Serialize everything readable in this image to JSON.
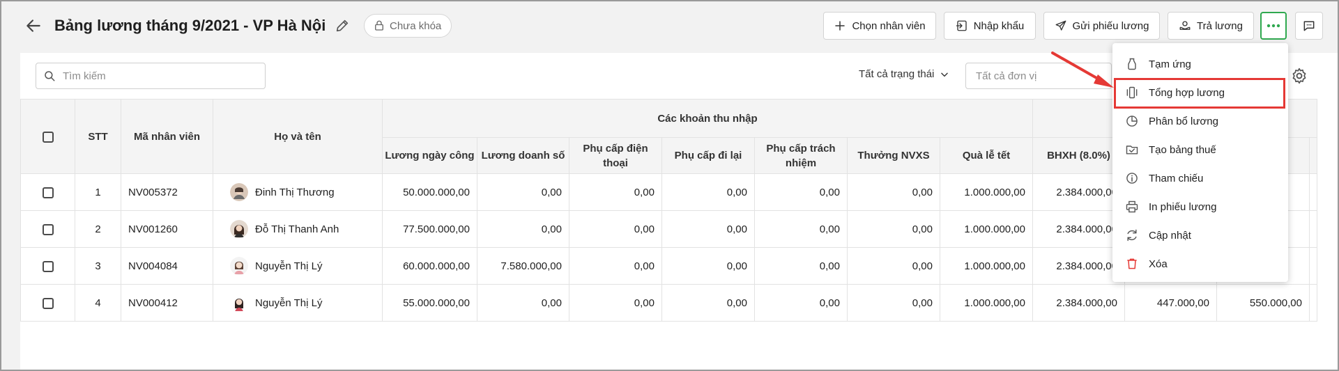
{
  "header": {
    "title": "Bảng lương tháng 9/2021 - VP Hà Nội",
    "lock_status": "Chưa khóa",
    "buttons": {
      "choose_employee": "Chọn nhân viên",
      "import": "Nhập khẩu",
      "send_payslip": "Gửi phiếu lương",
      "pay_salary": "Trả lương"
    }
  },
  "toolbar": {
    "search_placeholder": "Tìm kiếm",
    "status_filter": "Tất cả trạng thái",
    "unit_placeholder": "Tất cả đơn vị"
  },
  "table": {
    "headers": {
      "stt": "STT",
      "employee_code": "Mã nhân viên",
      "full_name": "Họ và tên",
      "income_group": "Các khoản thu nhập",
      "daily_wage": "Lương ngày công",
      "sales_wage": "Lương doanh số",
      "phone_allowance": "Phụ cấp điện thoại",
      "travel_allowance": "Phụ cấp đi lại",
      "responsibility_allowance": "Phụ cấp trách nhiệm",
      "bonus_nvxs": "Thưởng NVXS",
      "holiday_gift": "Quà lễ tết",
      "bhxh": "BHXH (8.0%)"
    },
    "rows": [
      {
        "stt": "1",
        "code": "NV005372",
        "name": "Đinh Thị Thương",
        "daily": "50.000.000,00",
        "sales": "0,00",
        "phone": "0,00",
        "travel": "0,00",
        "resp": "0,00",
        "bonus": "0,00",
        "gift": "1.000.000,00",
        "bhxh": "2.384.000,00",
        "c11": "",
        "c12": ""
      },
      {
        "stt": "2",
        "code": "NV001260",
        "name": "Đỗ Thị Thanh Anh",
        "daily": "77.500.000,00",
        "sales": "0,00",
        "phone": "0,00",
        "travel": "0,00",
        "resp": "0,00",
        "bonus": "0,00",
        "gift": "1.000.000,00",
        "bhxh": "2.384.000,00",
        "c11": "",
        "c12": ""
      },
      {
        "stt": "3",
        "code": "NV004084",
        "name": "Nguyễn Thị Lý",
        "daily": "60.000.000,00",
        "sales": "7.580.000,00",
        "phone": "0,00",
        "travel": "0,00",
        "resp": "0,00",
        "bonus": "0,00",
        "gift": "1.000.000,00",
        "bhxh": "2.384.000,00",
        "c11": "",
        "c12": ""
      },
      {
        "stt": "4",
        "code": "NV000412",
        "name": "Nguyễn Thị Lý",
        "daily": "55.000.000,00",
        "sales": "0,00",
        "phone": "0,00",
        "travel": "0,00",
        "resp": "0,00",
        "bonus": "0,00",
        "gift": "1.000.000,00",
        "bhxh": "2.384.000,00",
        "c11": "447.000,00",
        "c12": "550.000,00"
      }
    ]
  },
  "menu": {
    "items": [
      {
        "label": "Tạm ứng",
        "icon": "advance-icon"
      },
      {
        "label": "Tổng hợp lương",
        "icon": "salary-summary-icon"
      },
      {
        "label": "Phân bổ lương",
        "icon": "pie-chart-icon"
      },
      {
        "label": "Tạo bảng thuế",
        "icon": "tax-folder-icon"
      },
      {
        "label": "Tham chiếu",
        "icon": "info-icon"
      },
      {
        "label": "In phiếu lương",
        "icon": "printer-icon"
      },
      {
        "label": "Cập nhật",
        "icon": "refresh-icon"
      },
      {
        "label": "Xóa",
        "icon": "trash-icon"
      }
    ]
  },
  "colors": {
    "accent_green": "#2fa84f",
    "highlight_red": "#e53935",
    "delete_red": "#e53935"
  }
}
